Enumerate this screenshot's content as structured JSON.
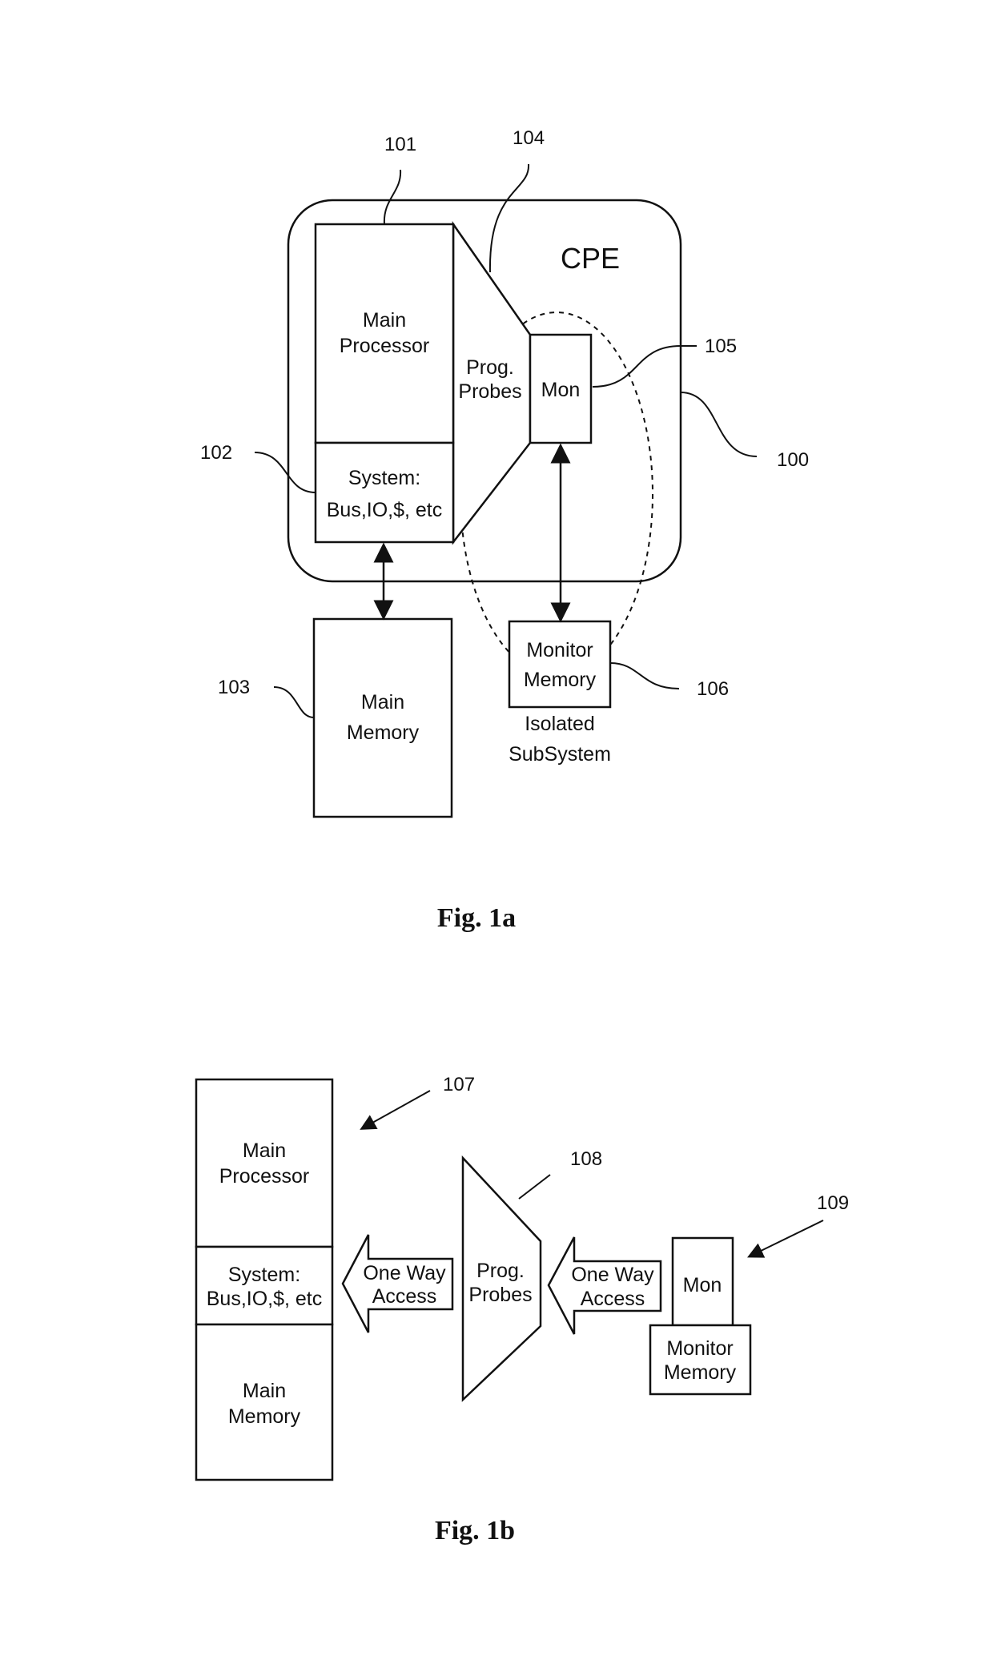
{
  "fig1a": {
    "caption": "Fig. 1a",
    "cpe_label": "CPE",
    "main_processor": [
      "Main",
      "Processor"
    ],
    "system": [
      "System:",
      "Bus,IO,$, etc"
    ],
    "prog_probes": [
      "Prog.",
      "Probes"
    ],
    "mon": "Mon",
    "main_memory": [
      "Main",
      "Memory"
    ],
    "monitor_memory": [
      "Monitor",
      "Memory"
    ],
    "isolated_subsystem": [
      "Isolated",
      "SubSystem"
    ],
    "refs": {
      "r100": "100",
      "r101": "101",
      "r102": "102",
      "r103": "103",
      "r104": "104",
      "r105": "105",
      "r106": "106"
    }
  },
  "fig1b": {
    "caption": "Fig. 1b",
    "main_processor": [
      "Main",
      "Processor"
    ],
    "system": [
      "System:",
      "Bus,IO,$, etc"
    ],
    "main_memory": [
      "Main",
      "Memory"
    ],
    "one_way_access": [
      "One Way",
      "Access"
    ],
    "prog_probes": [
      "Prog.",
      "Probes"
    ],
    "mon": "Mon",
    "monitor_memory": [
      "Monitor",
      "Memory"
    ],
    "refs": {
      "r107": "107",
      "r108": "108",
      "r109": "109"
    }
  }
}
